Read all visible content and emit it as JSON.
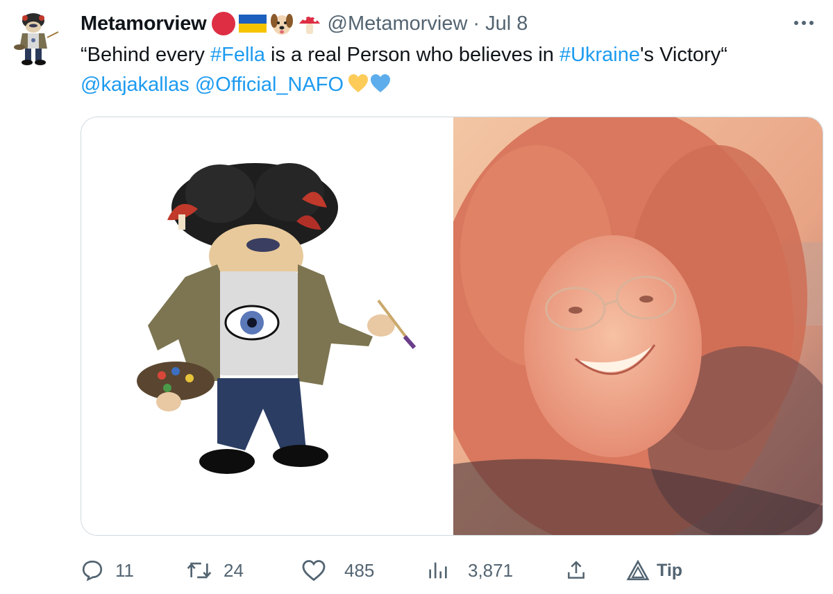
{
  "tweet": {
    "author_name": "Metamorview",
    "handle": "@Metamorview",
    "separator": "·",
    "date": "Jul 8",
    "name_emojis": [
      "red-circle-icon",
      "ukraine-flag-icon",
      "dog-face-icon",
      "mushroom-icon"
    ],
    "text": {
      "line1": {
        "open_quote": "“Behind every ",
        "hashtag1": "#Fella",
        "mid": " is a real Person who believes in ",
        "hashtag2": "#Ukraine",
        "end": "'s Victory“"
      },
      "line2": {
        "mention1": "@kajakallas",
        "space": " ",
        "mention2": "@Official_NAFO",
        "heart_icons": [
          "yellow-heart-icon",
          "blue-heart-icon"
        ]
      }
    },
    "media": [
      {
        "description": "cartoon-fella-artist"
      },
      {
        "description": "curly-haired-person-photo"
      }
    ]
  },
  "actions": {
    "reply": {
      "icon": "reply-icon",
      "count": "11"
    },
    "retweet": {
      "icon": "retweet-icon",
      "count": "24"
    },
    "like": {
      "icon": "heart-icon",
      "count": "485"
    },
    "views": {
      "icon": "views-icon",
      "count": "3,871"
    },
    "share": {
      "icon": "share-icon"
    },
    "tip": {
      "icon": "tip-icon",
      "label": "Tip"
    }
  },
  "colors": {
    "link": "#1d9bf0",
    "secondary_text": "#536471",
    "primary_text": "#0f1419",
    "border": "#cfd9de"
  }
}
